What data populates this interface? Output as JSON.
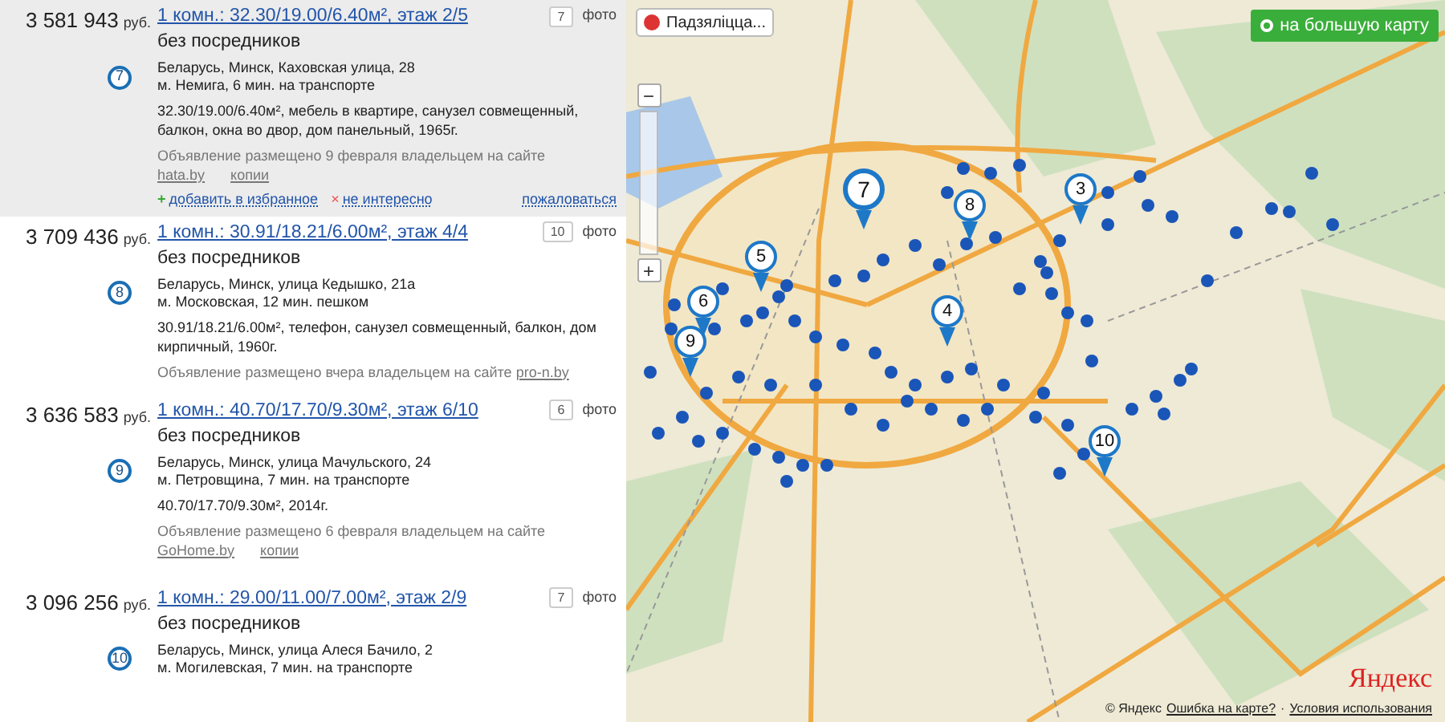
{
  "listings": [
    {
      "price": "3 581 943",
      "currency": "руб.",
      "title": "1 комн.: 32.30/19.00/6.40м², этаж 2/5",
      "photos": "7",
      "photo_label": "фото",
      "seller": "без посредников",
      "marker": "7",
      "address": [
        "Беларусь, Минск, Каховская улица, 28",
        "м. Немига, 6 мин. на транспорте"
      ],
      "description": "32.30/19.00/6.40м², мебель в квартире, санузел совмещенный, балкон, окна во двор, дом панельный, 1965г.",
      "posted": "Объявление размещено 9 февраля владельцем на сайте",
      "source": "hata.by",
      "copies": "копии",
      "highlighted": true,
      "actions": {
        "favorite_icon": "+",
        "favorite": "добавить в избранное",
        "not_interested_icon": "×",
        "not_interested": "не интересно",
        "report": "пожаловаться"
      }
    },
    {
      "price": "3 709 436",
      "currency": "руб.",
      "title": "1 комн.: 30.91/18.21/6.00м², этаж 4/4",
      "photos": "10",
      "photo_label": "фото",
      "seller": "без посредников",
      "marker": "8",
      "address": [
        "Беларусь, Минск, улица Кедышко, 21а",
        "м. Московская, 12 мин. пешком"
      ],
      "description": "30.91/18.21/6.00м², телефон, санузел совмещенный, балкон, дом кирпичный, 1960г.",
      "posted": "Объявление размещено вчера владельцем на сайте",
      "source": "pro-n.by",
      "highlighted": false
    },
    {
      "price": "3 636 583",
      "currency": "руб.",
      "title": "1 комн.: 40.70/17.70/9.30м², этаж 6/10",
      "photos": "6",
      "photo_label": "фото",
      "seller": "без посредников",
      "marker": "9",
      "address": [
        "Беларусь, Минск, улица Мачульского, 24",
        "м. Петровщина, 7 мин. на транспорте"
      ],
      "description": "40.70/17.70/9.30м², 2014г.",
      "posted": "Объявление размещено 6 февраля владельцем на сайте",
      "source": "GoHome.by",
      "copies": "копии",
      "highlighted": false
    },
    {
      "price": "3 096 256",
      "currency": "руб.",
      "title": "1 комн.: 29.00/11.00/7.00м², этаж 2/9",
      "photos": "7",
      "photo_label": "фото",
      "seller": "без посредников",
      "marker": "10",
      "address": [
        "Беларусь, Минск, улица Алеся Бачило, 2",
        "м. Могилевская, 7 мин. на транспорте"
      ],
      "highlighted": false
    }
  ],
  "map": {
    "share_button": "Падзяліцца...",
    "big_map_button": "на большую карту",
    "zoom_out": "−",
    "zoom_in": "+",
    "pins": [
      {
        "label": "7"
      },
      {
        "label": "8"
      },
      {
        "label": "3"
      },
      {
        "label": "5"
      },
      {
        "label": "6"
      },
      {
        "label": "4"
      },
      {
        "label": "9"
      },
      {
        "label": "10"
      }
    ],
    "copyright": "© Яндекс",
    "error_link": "Ошибка на карте?",
    "separator": "·",
    "terms_link": "Условия использования",
    "logo": "Яндекс"
  }
}
